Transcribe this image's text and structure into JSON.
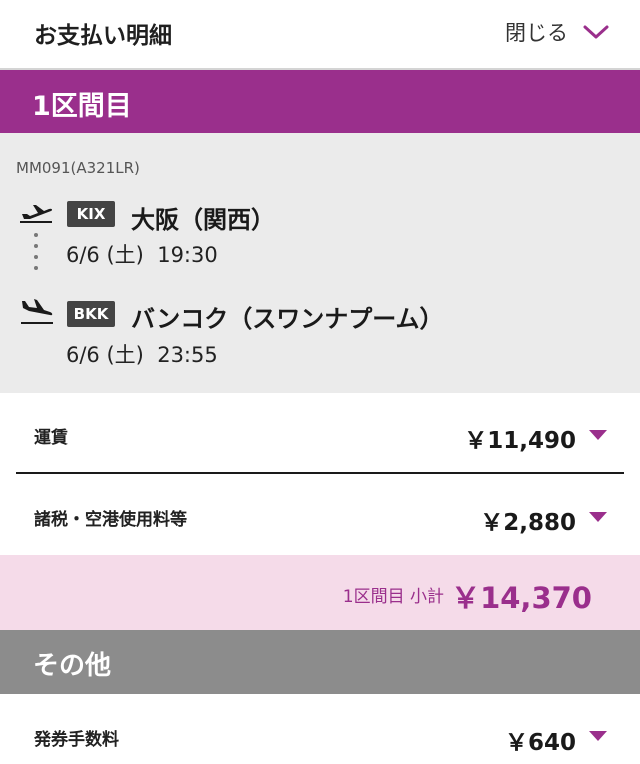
{
  "header": {
    "title": "お支払い明細",
    "close_label": "閉じる",
    "close_icon": "chevron-down-icon"
  },
  "section": {
    "title": "1区間目"
  },
  "flight": {
    "number": "MM091(A321LR)",
    "departure": {
      "code": "KIX",
      "airport": "大阪（関西）",
      "datetime": "6/6 (土)  19:30",
      "icon": "plane-takeoff-icon"
    },
    "arrival": {
      "code": "BKK",
      "airport": "バンコク（スワンナプーム）",
      "datetime": "6/6 (土)  23:55",
      "icon": "plane-landing-icon"
    }
  },
  "fares": [
    {
      "label": "運賃",
      "amount": "￥11,490"
    },
    {
      "label": "諸税・空港使用料等",
      "amount": "￥2,880"
    }
  ],
  "subtotal": {
    "label": "1区間目 小計",
    "amount": "￥14,370"
  },
  "other": {
    "title": "その他",
    "items": [
      {
        "label": "発券手数料",
        "amount": "￥640"
      }
    ]
  },
  "colors": {
    "accent": "#9a2f8c",
    "subtotal_bg": "#f5dbe9",
    "other_banner": "#8c8c8c",
    "flight_bg": "#ebebeb"
  }
}
